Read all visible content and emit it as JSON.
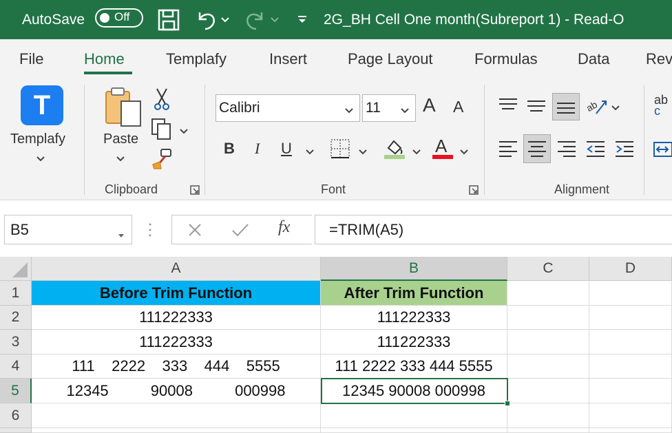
{
  "titlebar": {
    "autosave_label": "AutoSave",
    "autosave_state": "Off",
    "title": "2G_BH Cell One month(Subreport 1)  -  Read-O"
  },
  "tabs": [
    {
      "label": "File"
    },
    {
      "label": "Home"
    },
    {
      "label": "Templafy"
    },
    {
      "label": "Insert"
    },
    {
      "label": "Page Layout"
    },
    {
      "label": "Formulas"
    },
    {
      "label": "Data"
    },
    {
      "label": "Rev"
    }
  ],
  "ribbon": {
    "templafy_logo_letter": "T",
    "templafy_label": "Templafy",
    "paste_label": "Paste",
    "clipboard_label": "Clipboard",
    "font_name": "Calibri",
    "font_size": "11",
    "bold": "B",
    "italic": "I",
    "underline": "U",
    "font_color_glyph": "A",
    "grow_font_glyph": "A",
    "shrink_font_glyph": "A",
    "font_label": "Font",
    "alignment_label": "Alignment",
    "wrap_partial": "ab",
    "wrap_partial2": "c",
    "accent_fill_color": "#a9d18e",
    "accent_font_color": "#e81123"
  },
  "formula_bar": {
    "name_box": "B5",
    "fx": "fx",
    "formula": "=TRIM(A5)"
  },
  "grid": {
    "columns": [
      "A",
      "B",
      "C",
      "D"
    ],
    "rows": [
      "1",
      "2",
      "3",
      "4",
      "5",
      "6"
    ],
    "cells": {
      "A1": "Before Trim Function",
      "B1": "After Trim Function",
      "A2": "111222333",
      "B2": "111222333",
      "A3": "111222333",
      "B3": "111222333",
      "A4": "111    2222    333    444    5555",
      "B4": "111 2222 333 444 5555",
      "A5": "12345          90008          000998",
      "B5": "12345 90008 000998"
    },
    "header_a_color": "#00b0f0",
    "header_b_color": "#a9d18e"
  }
}
